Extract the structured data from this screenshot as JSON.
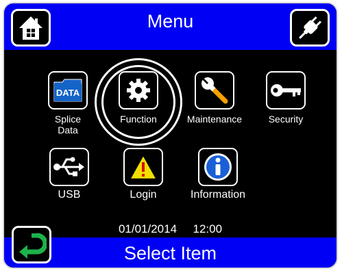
{
  "header": {
    "title": "Menu"
  },
  "footer": {
    "title": "Select Item"
  },
  "status": {
    "date": "01/01/2014",
    "time": "12:00"
  },
  "items": [
    {
      "label_line1": "Splice",
      "label_line2": "Data",
      "badge": "DATA"
    },
    {
      "label": "Function"
    },
    {
      "label": "Maintenance"
    },
    {
      "label": "Security"
    },
    {
      "label": "USB"
    },
    {
      "label": "Login"
    },
    {
      "label": "Information"
    }
  ],
  "icons": {
    "home": "home-icon",
    "plug": "power-plug-icon",
    "back": "return-arrow-icon",
    "splice_data": "folder-data-icon",
    "function": "gear-icon",
    "maintenance": "wrench-icon",
    "security": "key-icon",
    "usb": "usb-icon",
    "login": "warning-icon",
    "information": "info-icon"
  },
  "colors": {
    "bar": "#0000f5",
    "background": "#000000",
    "back_arrow": "#1db24a",
    "selected_ring": "#ffffff"
  }
}
